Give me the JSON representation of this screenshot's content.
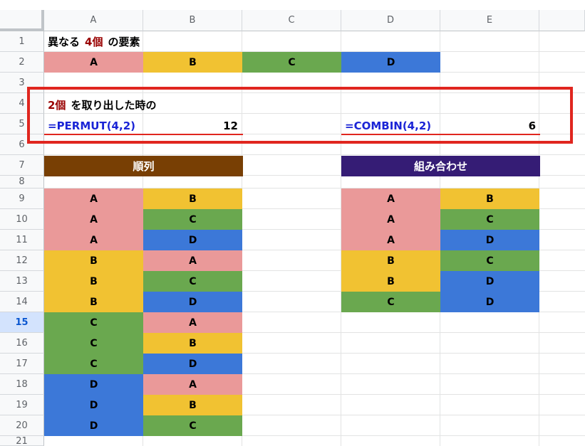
{
  "columns": [
    "A",
    "B",
    "C",
    "D",
    "E"
  ],
  "rows": [
    "1",
    "2",
    "3",
    "4",
    "5",
    "6",
    "7",
    "8",
    "9",
    "10",
    "11",
    "12",
    "13",
    "14",
    "15",
    "16",
    "17",
    "18",
    "19",
    "20",
    "21"
  ],
  "selected_row": "15",
  "colors": {
    "A": "#ea9999",
    "B": "#f1c232",
    "C": "#6aa84f",
    "D": "#3c78d8",
    "permutation_header": "#783f04",
    "combination_header": "#351c75",
    "highlight_box": "#e0261f",
    "number_text": "#990000",
    "formula_text": "#1a24d6"
  },
  "title": {
    "prefix": "異なる",
    "number": "4個",
    "suffix": "の要素"
  },
  "elements": [
    "A",
    "B",
    "C",
    "D"
  ],
  "box": {
    "number": "2個",
    "suffix": "を取り出した時の",
    "permut_formula": "=PERMUT(4,2)",
    "permut_result": "12",
    "combin_formula": "=COMBIN(4,2)",
    "combin_result": "6"
  },
  "permutation": {
    "header": "順列",
    "pairs": [
      [
        "A",
        "B"
      ],
      [
        "A",
        "C"
      ],
      [
        "A",
        "D"
      ],
      [
        "B",
        "A"
      ],
      [
        "B",
        "C"
      ],
      [
        "B",
        "D"
      ],
      [
        "C",
        "A"
      ],
      [
        "C",
        "B"
      ],
      [
        "C",
        "D"
      ],
      [
        "D",
        "A"
      ],
      [
        "D",
        "B"
      ],
      [
        "D",
        "C"
      ]
    ]
  },
  "combination": {
    "header": "組み合わせ",
    "pairs": [
      [
        "A",
        "B"
      ],
      [
        "A",
        "C"
      ],
      [
        "A",
        "D"
      ],
      [
        "B",
        "C"
      ],
      [
        "B",
        "D"
      ],
      [
        "C",
        "D"
      ]
    ]
  }
}
